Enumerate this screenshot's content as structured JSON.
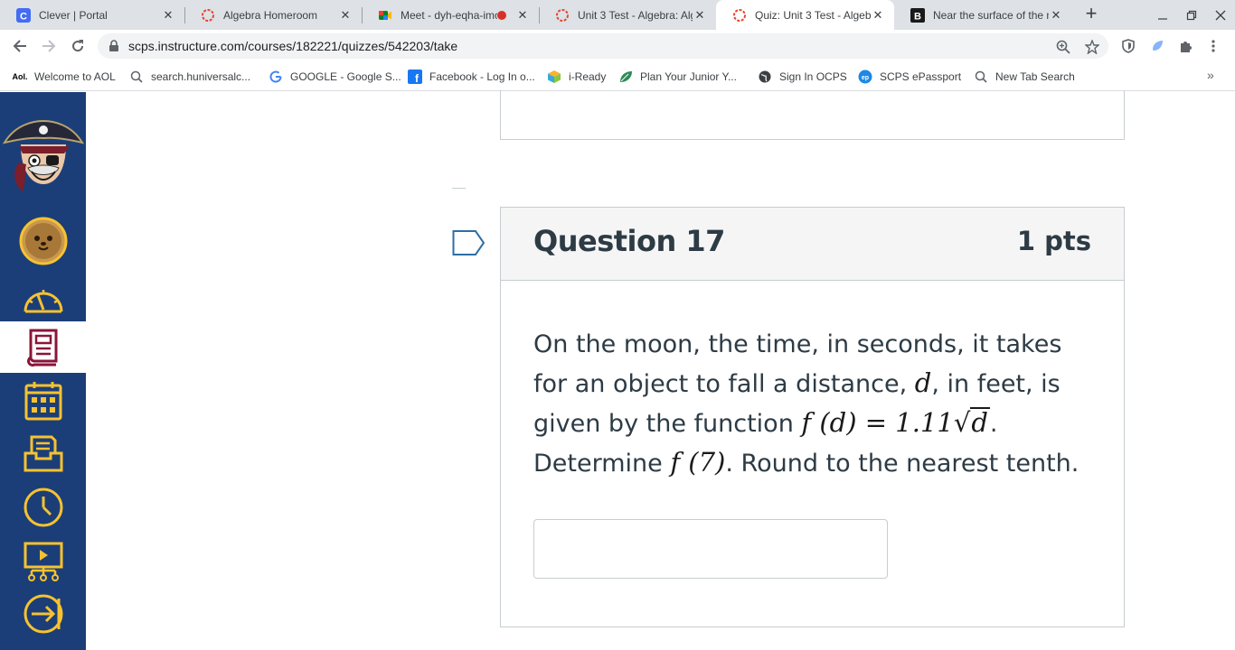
{
  "tabs": [
    {
      "title": "Clever | Portal",
      "icon": "clever-icon"
    },
    {
      "title": "Algebra Homeroom",
      "icon": "canvas-icon"
    },
    {
      "title": "Meet - dyh-eqha-imo",
      "icon": "meet-icon",
      "recording": true
    },
    {
      "title": "Unit 3 Test - Algebra: Alg",
      "icon": "canvas-icon"
    },
    {
      "title": "Quiz: Unit 3 Test - Algebr",
      "icon": "canvas-icon",
      "active": true
    },
    {
      "title": "Near the surface of the n",
      "icon": "brainly-icon"
    }
  ],
  "address_bar": {
    "url": "scps.instructure.com/courses/182221/quizzes/542203/take"
  },
  "bookmarks": [
    {
      "label": "Welcome to AOL",
      "icon": "aol-icon"
    },
    {
      "label": "search.huniversalc...",
      "icon": "search-icon"
    },
    {
      "label": "GOOGLE - Google S...",
      "icon": "google-icon"
    },
    {
      "label": "Facebook - Log In o...",
      "icon": "facebook-icon"
    },
    {
      "label": "i-Ready",
      "icon": "iready-icon"
    },
    {
      "label": "Plan Your Junior Y...",
      "icon": "leaf-icon"
    },
    {
      "label": "Sign In OCPS",
      "icon": "globe-icon"
    },
    {
      "label": "SCPS ePassport",
      "icon": "epassport-icon"
    },
    {
      "label": "New Tab Search",
      "icon": "search-icon"
    }
  ],
  "nav": {
    "items": [
      "pirate-logo",
      "account-avatar",
      "dashboard-icon",
      "courses-icon",
      "calendar-icon",
      "inbox-icon",
      "history-icon",
      "studio-icon",
      "help-icon"
    ],
    "active": "courses-icon",
    "colors": {
      "background": "#1c3e78",
      "icon": "#f6c230",
      "active_icon": "#8a1538"
    }
  },
  "question": {
    "title": "Question 17",
    "points": "1 pts",
    "text_1": "On the moon, the time, in seconds, it takes for an object to fall a distance, ",
    "var_d": "d",
    "text_2": ", in feet, is given by the function ",
    "formula_lhs": "f (d) = 1.11",
    "formula_sqrt": "d",
    "text_3": ". Determine ",
    "formula_eval": "f (7)",
    "text_4": ". Round to the nearest tenth."
  },
  "answer_field": {
    "value": ""
  }
}
